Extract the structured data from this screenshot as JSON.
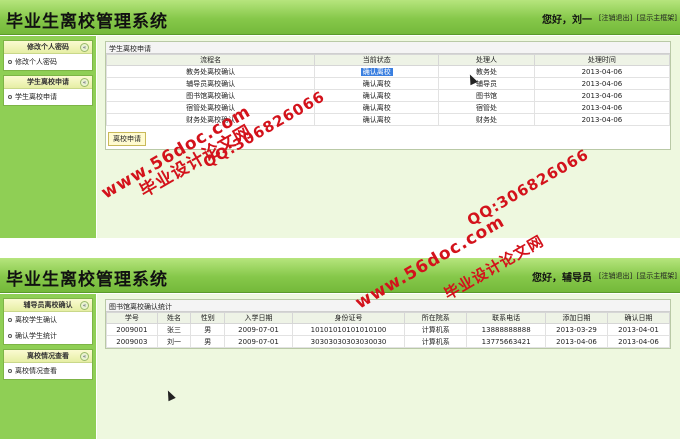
{
  "screen1": {
    "app_title": "毕业生离校管理系统",
    "greeting": "您好，刘一",
    "links": [
      "[注销退出]",
      "[显示主框架]"
    ],
    "sidebar": [
      {
        "title": "修改个人密码",
        "items": [
          "修改个人密码"
        ]
      },
      {
        "title": "学生离校申请",
        "items": [
          "学生离校申请"
        ]
      }
    ],
    "card_title": "学生离校申请",
    "columns": [
      "流程名",
      "当前状态",
      "处理人",
      "处理时间"
    ],
    "rows": [
      [
        "教务处离校确认",
        "确认离校",
        "教务处",
        "2013-04-06"
      ],
      [
        "辅导员离校确认",
        "确认离校",
        "辅导员",
        "2013-04-06"
      ],
      [
        "图书馆离校确认",
        "确认离校",
        "图书馆",
        "2013-04-06"
      ],
      [
        "宿管处离校确认",
        "确认离校",
        "宿管处",
        "2013-04-06"
      ],
      [
        "财务处离校确认",
        "确认离校",
        "财务处",
        "2013-04-06"
      ]
    ],
    "apply_button": "离校申请"
  },
  "screen2": {
    "app_title": "毕业生离校管理系统",
    "greeting": "您好，辅导员",
    "links": [
      "[注销退出]",
      "[显示主框架]"
    ],
    "sidebar": [
      {
        "title": "辅导员离校确认",
        "items": [
          "离校学生确认",
          "确认学生统计"
        ]
      },
      {
        "title": "离校情况查看",
        "items": [
          "离校情况查看"
        ]
      }
    ],
    "card_title": "图书馆离校确认统计",
    "columns": [
      "学号",
      "姓名",
      "性别",
      "入学日期",
      "身份证号",
      "所在院系",
      "联系电话",
      "添加日期",
      "确认日期"
    ],
    "rows": [
      [
        "2009001",
        "张三",
        "男",
        "2009-07-01",
        "10101010101010100",
        "计算机系",
        "13888888888",
        "2013-03-29",
        "2013-04-01"
      ],
      [
        "2009003",
        "刘一",
        "男",
        "2009-07-01",
        "30303030303030030",
        "计算机系",
        "13775663421",
        "2013-04-06",
        "2013-04-06"
      ]
    ]
  },
  "watermarks": {
    "site": "www.56doc.com",
    "qq": "QQ:306826066",
    "brand": "毕业设计论文网"
  },
  "colors": {
    "accent_green": "#86c84a",
    "watermark_red": "#d3121b",
    "highlight": "#3a7fe0"
  }
}
